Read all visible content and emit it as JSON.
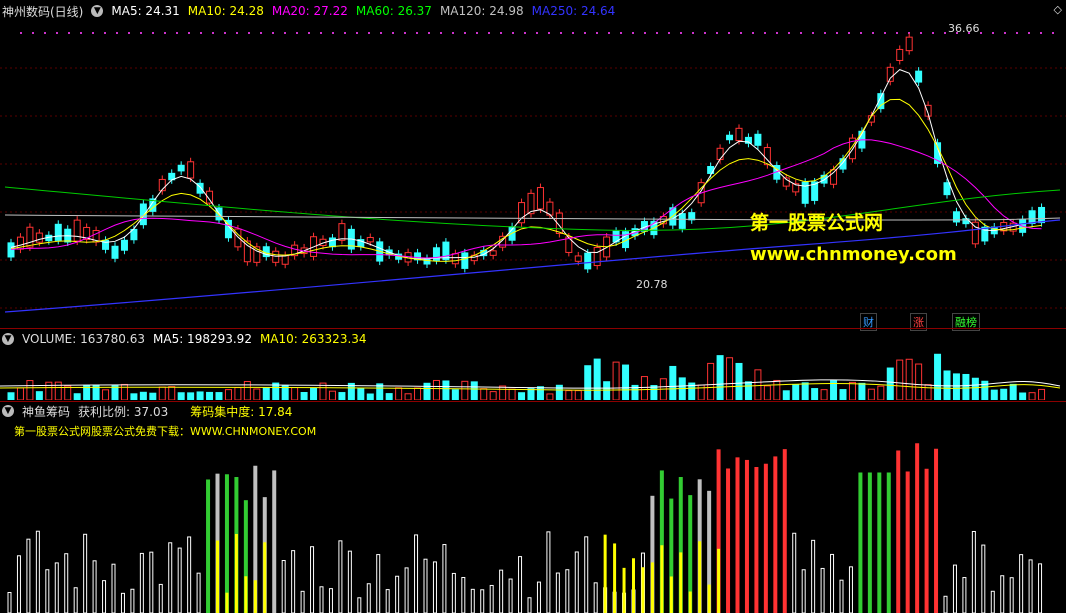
{
  "stock": {
    "title": "神州数码(日线)",
    "ma_labels": [
      {
        "text": "MA5: 24.31",
        "color": "#ffffff"
      },
      {
        "text": "MA10: 24.28",
        "color": "#ffff00"
      },
      {
        "text": "MA20: 27.22",
        "color": "#ff00ff"
      },
      {
        "text": "MA60: 26.37",
        "color": "#00ff00"
      },
      {
        "text": "MA120: 24.98",
        "color": "#c0c0c0"
      },
      {
        "text": "MA250: 24.64",
        "color": "#3333ff"
      }
    ],
    "high_label": "36.66",
    "low_label": "20.78",
    "badges": [
      {
        "text": "财",
        "color": "#3399ff"
      },
      {
        "text": "涨",
        "color": "#ff4040"
      },
      {
        "text": "融榜",
        "color": "#33ff33"
      }
    ]
  },
  "volume": {
    "title": "VOLUME: 163780.63",
    "ma5": "MA5: 198293.92",
    "ma10": "MA10: 263323.34"
  },
  "indicator": {
    "title": "神鱼筹码",
    "profit": "获利比例: 37.03",
    "concentration": "筹码集中度: 17.84",
    "ad": "第一股票公式网股票公式免费下载：WWW.CHNMONEY.COM"
  },
  "watermark": {
    "line1": "第一股票公式网",
    "line2": "www.chnmoney.com"
  },
  "icons": {
    "collapse": "chevron-diamond-icon",
    "toggle": "circle-toggle-icon"
  }
}
